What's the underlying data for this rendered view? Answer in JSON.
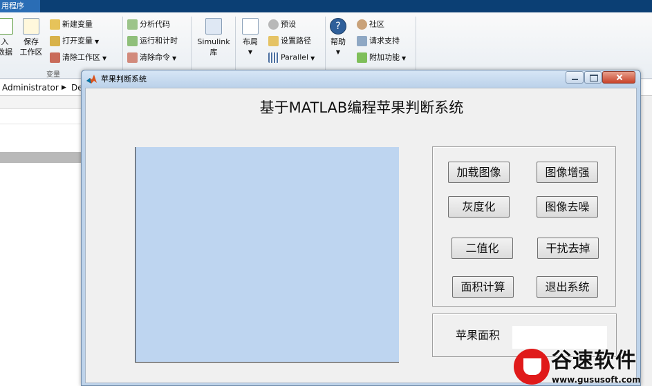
{
  "matlab": {
    "app_tab": "用程序",
    "ribbon": {
      "import_label_1": "入",
      "import_label_2": "数据",
      "save_label_1": "保存",
      "save_label_2": "工作区",
      "new_variable": "新建变量",
      "open_variable": "打开变量",
      "clear_workspace": "清除工作区",
      "variable_group": "变量",
      "analyze_code": "分析代码",
      "run_and_time": "运行和计时",
      "clear_commands": "清除命令",
      "simulink_label_1": "Simulink",
      "simulink_label_2": "库",
      "layout": "布局",
      "preferences": "预设",
      "set_path": "设置路径",
      "parallel": "Parallel",
      "help": "帮助",
      "community": "社区",
      "request_support": "请求支持",
      "add_ons": "附加功能"
    },
    "address": {
      "user": "Administrator",
      "next": "De"
    }
  },
  "figure": {
    "window_title": "苹果判断系统",
    "heading": "基于MATLAB编程苹果判断系统",
    "buttons": {
      "load_image": "加载图像",
      "enhance_image": "图像增强",
      "grayscale": "灰度化",
      "denoise_image": "图像去噪",
      "binarize": "二值化",
      "remove_interference": "干扰去掉",
      "calculate_area": "面积计算",
      "exit_system": "退出系统"
    },
    "area_label": "苹果面积",
    "area_value": ""
  },
  "colors": {
    "axes_bg": "#bed5f0",
    "figure_bg": "#f0f0f0",
    "title_bar": "#0b3f74"
  },
  "watermark": {
    "name": "谷速软件",
    "url": "www.gususoft.com"
  }
}
